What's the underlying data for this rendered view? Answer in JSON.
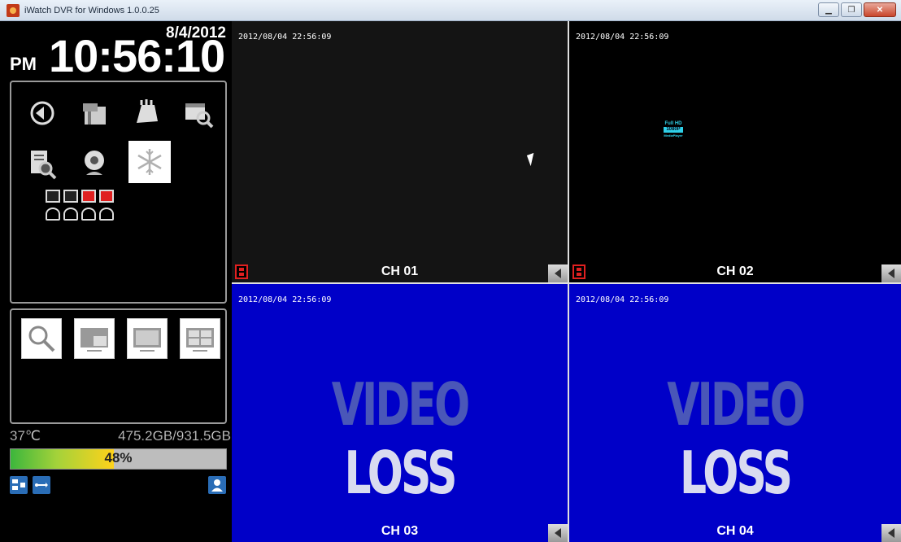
{
  "window": {
    "title": "iWatch DVR for Windows 1.0.0.25",
    "buttons": [
      "minimize",
      "maximize",
      "close"
    ]
  },
  "clock": {
    "date": "8/4/2012",
    "ampm": "PM",
    "time": "10:56:10"
  },
  "function_icons": [
    "playback-icon",
    "backup-icon",
    "ptz-icon",
    "schedule-search-icon",
    "log-search-icon",
    "webcam-icon",
    "freeze-icon"
  ],
  "view_buttons": [
    "zoom-icon",
    "pip-layout-icon",
    "single-view-icon",
    "quad-view-icon"
  ],
  "status": {
    "temperature": "37℃",
    "disk": "475.2GB/931.5GB",
    "usage_label": "48%",
    "usage_fraction": 0.48
  },
  "channels": [
    {
      "label": "CH 01",
      "timestamp": "2012/08/04 22:56:09",
      "state": "live"
    },
    {
      "label": "CH 02",
      "timestamp": "2012/08/04 22:56:09",
      "state": "live"
    },
    {
      "label": "CH 03",
      "timestamp": "2012/08/04 22:56:09",
      "state": "video-loss"
    },
    {
      "label": "CH 04",
      "timestamp": "2012/08/04 22:56:09",
      "state": "video-loss"
    }
  ],
  "video_loss": {
    "word1": "VIDEO",
    "word2": "LOSS"
  },
  "fullhd_badge": {
    "line1": "Full HD",
    "line2": "1080P",
    "line3": "MediaPlayer"
  }
}
